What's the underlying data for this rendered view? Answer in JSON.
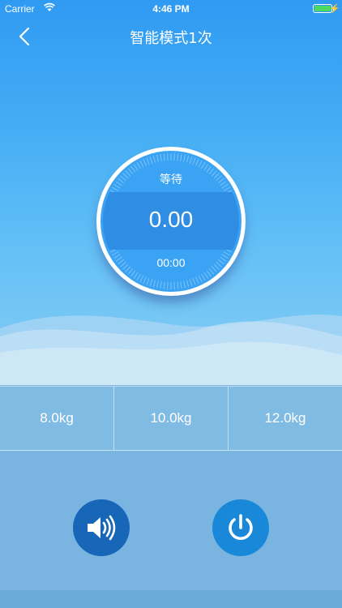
{
  "status_bar": {
    "carrier": "Carrier",
    "time": "4:46 PM",
    "charge_symbol": "⚡"
  },
  "nav": {
    "title": "智能模式1次",
    "back_icon": "chevron-left-icon"
  },
  "dial": {
    "status": "等待",
    "value": "0.00",
    "timer": "00:00"
  },
  "weights": [
    {
      "label": "8.0kg"
    },
    {
      "label": "10.0kg"
    },
    {
      "label": "12.0kg"
    }
  ],
  "controls": {
    "sound_icon": "speaker-icon",
    "power_icon": "power-icon"
  },
  "colors": {
    "sky_top": "#2f9af2",
    "sky_bottom": "#86cdf3",
    "dial_blue": "#3aa3f4",
    "sound_button": "#1766b8",
    "power_button": "#1a88d8",
    "battery": "#4cd964"
  }
}
